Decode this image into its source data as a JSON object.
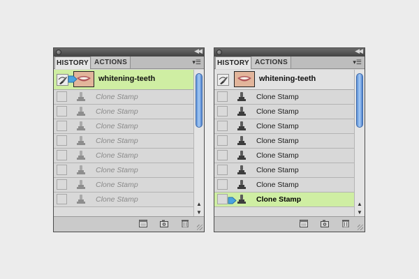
{
  "panels": [
    {
      "id": "left",
      "tabs": {
        "history": "HISTORY",
        "actions": "ACTIONS"
      },
      "snapshot": {
        "label": "whitening-teeth",
        "selected": true
      },
      "steps": [
        {
          "label": "Clone Stamp",
          "state": "undone"
        },
        {
          "label": "Clone Stamp",
          "state": "undone"
        },
        {
          "label": "Clone Stamp",
          "state": "undone"
        },
        {
          "label": "Clone Stamp",
          "state": "undone"
        },
        {
          "label": "Clone Stamp",
          "state": "undone"
        },
        {
          "label": "Clone Stamp",
          "state": "undone"
        },
        {
          "label": "Clone Stamp",
          "state": "undone"
        },
        {
          "label": "Clone Stamp",
          "state": "undone"
        }
      ]
    },
    {
      "id": "right",
      "tabs": {
        "history": "HISTORY",
        "actions": "ACTIONS"
      },
      "snapshot": {
        "label": "whitening-teeth",
        "selected": false
      },
      "steps": [
        {
          "label": "Clone Stamp",
          "state": "done"
        },
        {
          "label": "Clone Stamp",
          "state": "done"
        },
        {
          "label": "Clone Stamp",
          "state": "done"
        },
        {
          "label": "Clone Stamp",
          "state": "done"
        },
        {
          "label": "Clone Stamp",
          "state": "done"
        },
        {
          "label": "Clone Stamp",
          "state": "done"
        },
        {
          "label": "Clone Stamp",
          "state": "done"
        },
        {
          "label": "Clone Stamp",
          "state": "current"
        }
      ]
    }
  ],
  "icons": {
    "close": "close-dot-icon",
    "collapse": "double-chevron-left-icon",
    "menu": "panel-menu-icon",
    "brush": "history-brush-icon",
    "stamp": "clone-stamp-icon",
    "new_document": "new-document-from-state-icon",
    "snapshot": "camera-icon",
    "trash": "trash-icon"
  },
  "colors": {
    "selected_row": "#cfeea3",
    "scroll_thumb": "#5b8fd6"
  }
}
